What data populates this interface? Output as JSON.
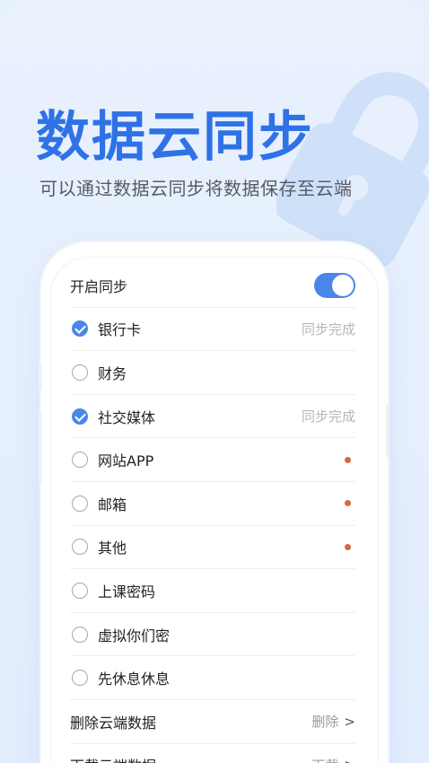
{
  "hero": {
    "title": "数据云同步",
    "subtitle": "可以通过数据云同步将数据保存至云端"
  },
  "settings": {
    "sync_toggle": {
      "label": "开启同步",
      "on": true
    },
    "items": [
      {
        "label": "银行卡",
        "checked": true,
        "status": "同步完成",
        "dot": false
      },
      {
        "label": "财务",
        "checked": false,
        "status": "",
        "dot": false
      },
      {
        "label": "社交媒体",
        "checked": true,
        "status": "同步完成",
        "dot": false
      },
      {
        "label": "网站APP",
        "checked": false,
        "status": "",
        "dot": true
      },
      {
        "label": "邮箱",
        "checked": false,
        "status": "",
        "dot": true
      },
      {
        "label": "其他",
        "checked": false,
        "status": "",
        "dot": true
      },
      {
        "label": "上课密码",
        "checked": false,
        "status": "",
        "dot": false
      },
      {
        "label": "虚拟你们密",
        "checked": false,
        "status": "",
        "dot": false
      },
      {
        "label": "先休息休息",
        "checked": false,
        "status": "",
        "dot": false
      }
    ],
    "actions": [
      {
        "label": "删除云端数据",
        "action": "删除",
        "chevron": ">"
      },
      {
        "label": "下载云端数据",
        "action": "下载",
        "chevron": ">"
      }
    ]
  },
  "colors": {
    "accent": "#4a86ea",
    "title_blue": "#2f72e6",
    "dot": "#d9683c"
  },
  "icons": [
    "lock-icon",
    "check-icon",
    "chevron-right-icon"
  ]
}
